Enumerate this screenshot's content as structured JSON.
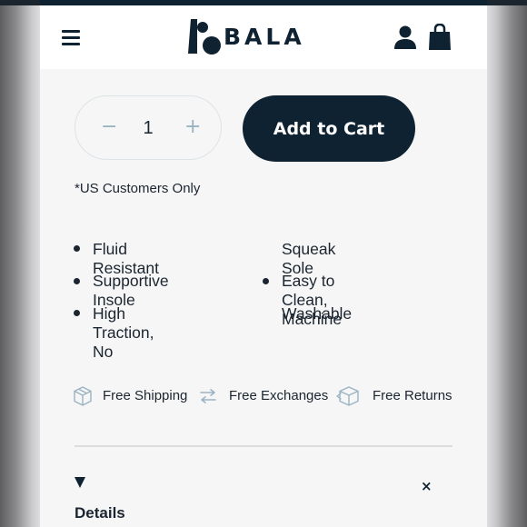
{
  "brand": {
    "name": "BALA"
  },
  "cart": {
    "quantity": "1",
    "minus_label": "−",
    "plus_label": "+",
    "add_to_cart_label": "Add to Cart",
    "availability_note": "*US Customers Only"
  },
  "features": {
    "left_column": [
      "Fluid Resistant",
      "Supportive Insole",
      "High Traction, No"
    ],
    "right_column": [
      "Squeak Sole",
      "Easy to Clean, Machine",
      "Washable"
    ]
  },
  "perks": [
    {
      "label": "Free Shipping",
      "icon": "box-icon"
    },
    {
      "label": "Free Exchanges",
      "icon": "swap-arrows-icon"
    },
    {
      "label": "Free Returns",
      "icon": "box-return-icon"
    }
  ],
  "accordion": {
    "toggle_icon": "triangle-down-icon",
    "close_icon": "close-icon",
    "close_glyph": "×",
    "title": "Details"
  },
  "colors": {
    "navy": "#0f2231",
    "icon_muted": "#9ab3c2",
    "page_bg": "#f6f6f6"
  }
}
